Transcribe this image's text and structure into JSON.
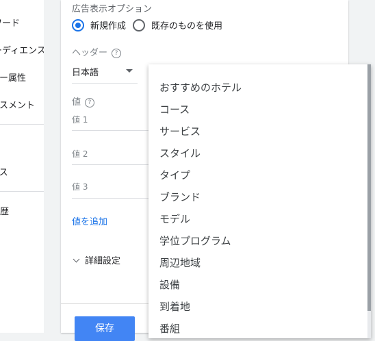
{
  "sidebar": {
    "items": [
      {
        "label": "ワード"
      },
      {
        "label": "ーディエンス"
      },
      {
        "label": "ダー属性"
      },
      {
        "label": "セスメント"
      },
      {
        "label": "イス"
      },
      {
        "label": "履歴"
      }
    ]
  },
  "form": {
    "options_label": "広告表示オプション",
    "radio_new": "新規作成",
    "radio_existing": "既存のものを使用",
    "header_label": "ヘッダー",
    "header_value": "日本語",
    "values_label": "値",
    "value1_placeholder": "値 1",
    "value2_placeholder": "値 2",
    "value3_placeholder": "値 3",
    "add_value_link": "値を追加",
    "advanced_settings": "詳細設定",
    "save_button": "保存",
    "help_glyph": "?"
  },
  "dropdown": {
    "items": [
      {
        "label": "おすすめのホテル"
      },
      {
        "label": "コース"
      },
      {
        "label": "サービス"
      },
      {
        "label": "スタイル"
      },
      {
        "label": "タイプ"
      },
      {
        "label": "ブランド"
      },
      {
        "label": "モデル"
      },
      {
        "label": "学位プログラム"
      },
      {
        "label": "周辺地域"
      },
      {
        "label": "設備"
      },
      {
        "label": "到着地"
      },
      {
        "label": "番組"
      }
    ]
  },
  "colors": {
    "accent": "#1a73e8",
    "save_button": "#4285f4"
  }
}
